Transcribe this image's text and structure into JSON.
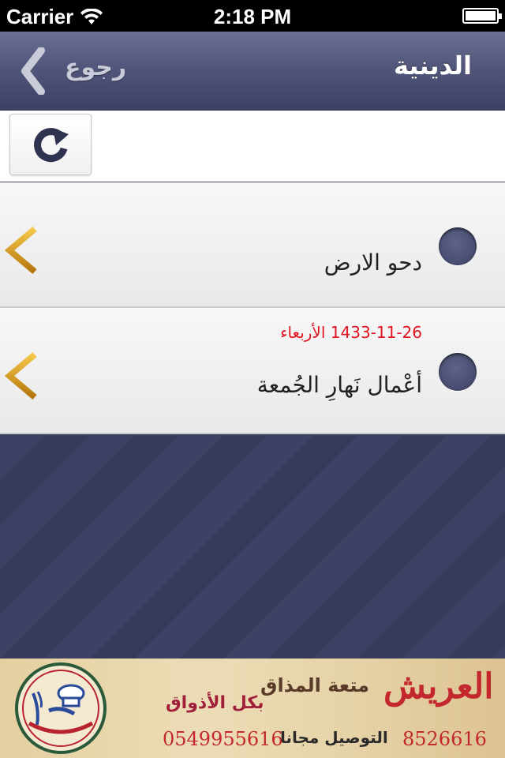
{
  "status_bar": {
    "carrier": "Carrier",
    "time": "2:18 PM"
  },
  "nav": {
    "title": "الدينية",
    "back_label": "رجوع"
  },
  "toolbar": {
    "refresh_icon": "refresh-icon"
  },
  "list": {
    "items": [
      {
        "title": "دحو الارض",
        "date": ""
      },
      {
        "title": "أعْمال نَهارِ الجُمعة",
        "date": "1433-11-26 الأربعاء"
      }
    ]
  },
  "ad": {
    "brand": "العريش",
    "slogan": "متعة المذاق",
    "slogan2": "بكل الأذواق",
    "delivery": "التوصيل مجانا",
    "phone1": "0549955616",
    "phone2": "8526616"
  },
  "colors": {
    "nav_bg": "#51567a",
    "list_bg": "#f2f2f2",
    "accent_gold": "#e0a51c",
    "date_red": "#e0141e",
    "dot": "#4a4f73"
  }
}
